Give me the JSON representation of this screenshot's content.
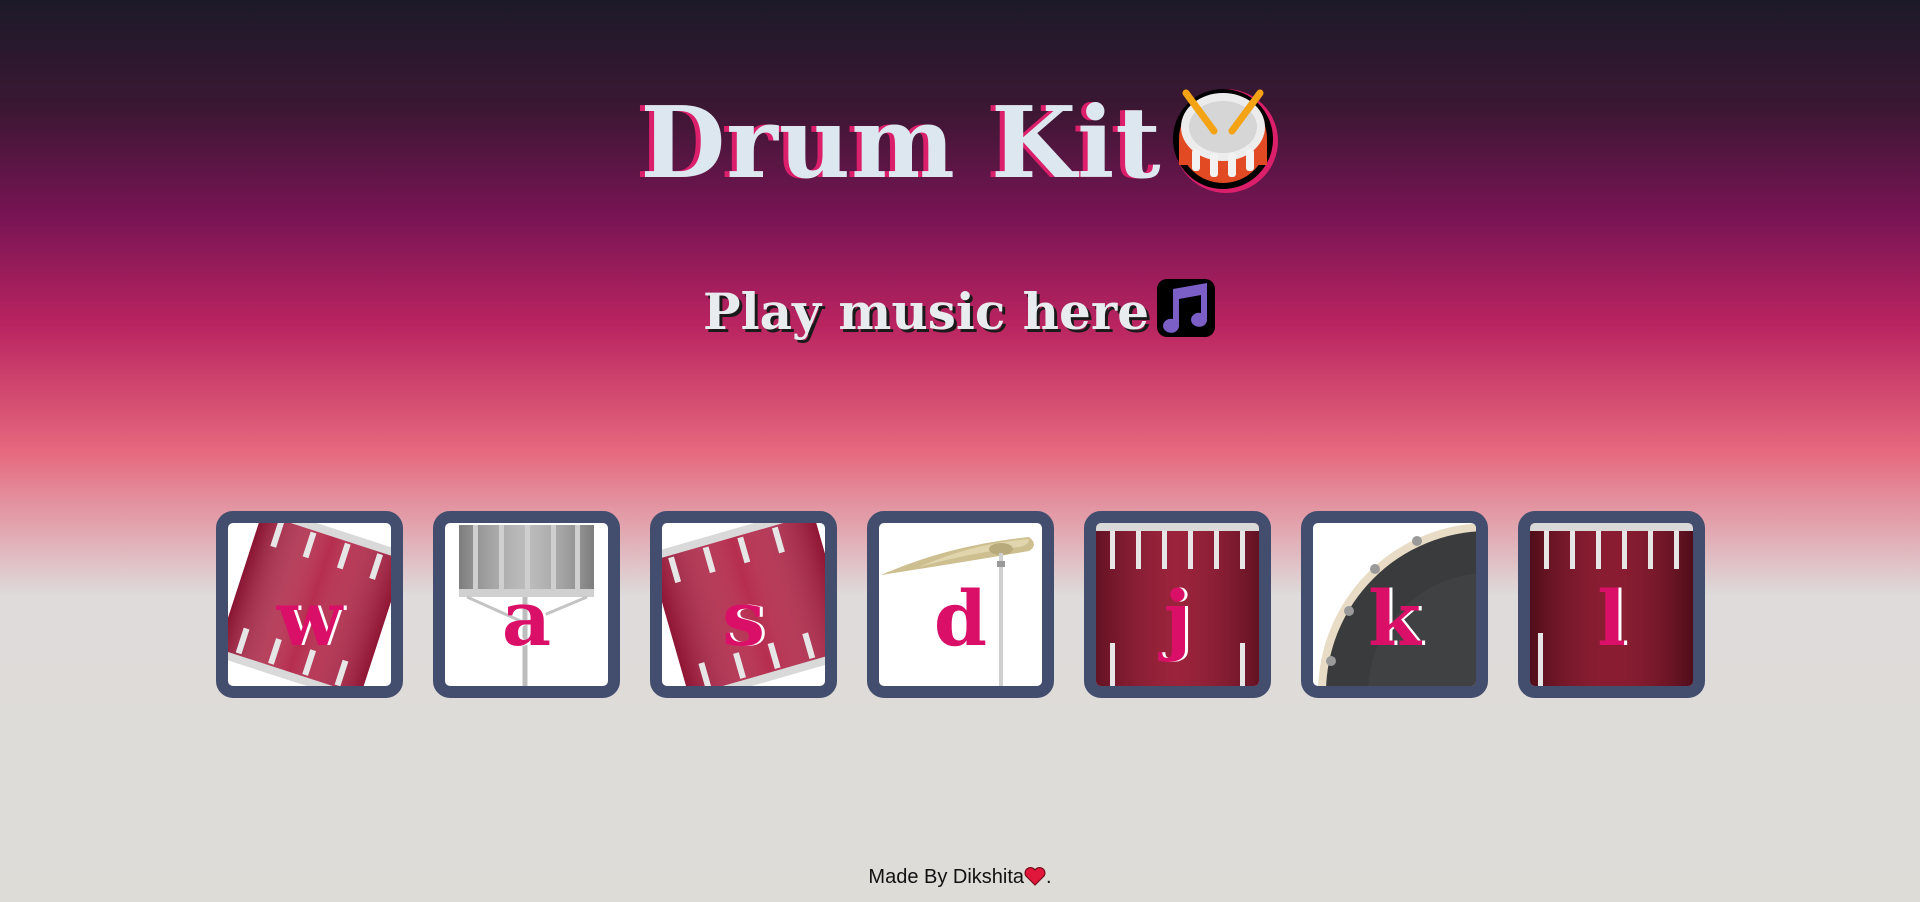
{
  "header": {
    "title": "Drum Kit",
    "title_icon": "drum-emoji",
    "subtitle": "Play music here",
    "subtitle_icon": "musical-notes-emoji"
  },
  "drums": [
    {
      "key": "w",
      "image": "tom-drum-tilted"
    },
    {
      "key": "a",
      "image": "snare-drum-silver"
    },
    {
      "key": "s",
      "image": "tom-drum-tilted"
    },
    {
      "key": "d",
      "image": "crash-cymbal"
    },
    {
      "key": "j",
      "image": "floor-tom-red"
    },
    {
      "key": "k",
      "image": "bass-drum-kick"
    },
    {
      "key": "l",
      "image": "floor-tom-red"
    }
  ],
  "footer": {
    "text": "Made By Dikshita",
    "suffix": ".",
    "icon": "heart-emoji"
  },
  "colors": {
    "title_text": "#dce7f0",
    "title_shadow": "#db1f6b",
    "key_letter": "#da0f68",
    "drum_border": "#434e6e"
  }
}
